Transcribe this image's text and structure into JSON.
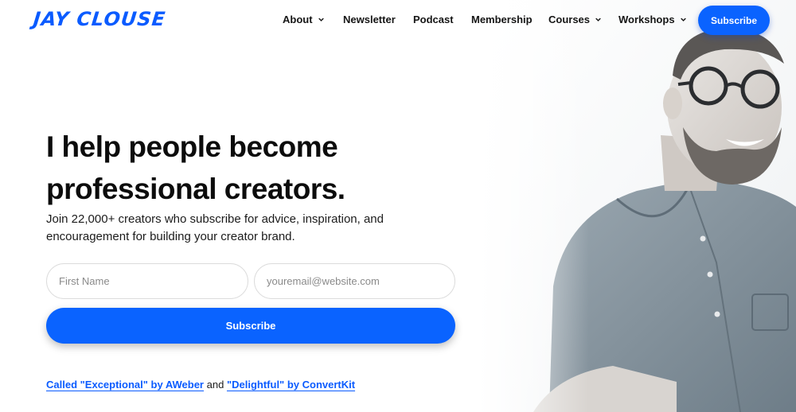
{
  "brand": {
    "logo_text": "JAY CLOUSE",
    "accent_color": "#0a63ff"
  },
  "nav": {
    "items": [
      {
        "label": "About",
        "has_dropdown": true
      },
      {
        "label": "Newsletter",
        "has_dropdown": false
      },
      {
        "label": "Podcast",
        "has_dropdown": false
      },
      {
        "label": "Membership",
        "has_dropdown": false
      },
      {
        "label": "Courses",
        "has_dropdown": true
      },
      {
        "label": "Workshops",
        "has_dropdown": true
      }
    ],
    "cta_label": "Subscribe"
  },
  "hero": {
    "headline_line1": "I help people become",
    "headline_line2": "professional creators.",
    "subtext": "Join 22,000+ creators who subscribe for advice, inspiration, and encouragement for building your creator brand."
  },
  "form": {
    "first_name_placeholder": "First Name",
    "email_placeholder": "youremail@website.com",
    "submit_label": "Subscribe"
  },
  "praise": {
    "link1": "Called \"Exceptional\" by AWeber",
    "joiner": "and",
    "link2": "\"Delightful\" by ConvertKit"
  }
}
